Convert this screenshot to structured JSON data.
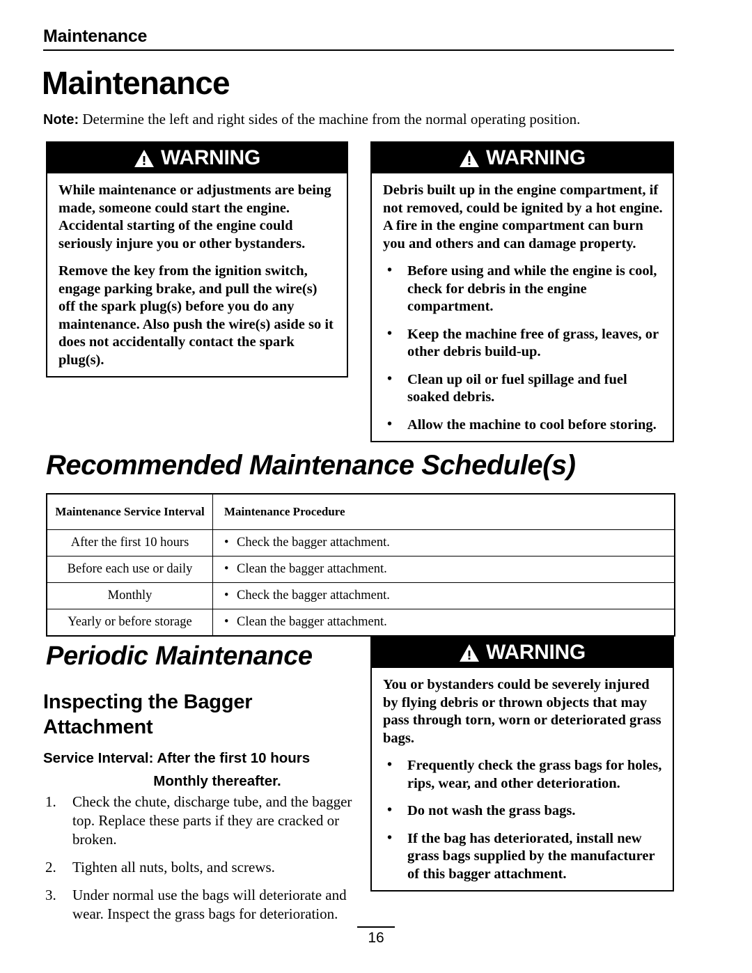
{
  "running_header": {
    "text": "Maintenance"
  },
  "page_title": "Maintenance",
  "note": {
    "label": "Note:",
    "body": " Determine the left and right sides of the machine from the normal operating position."
  },
  "warnings": {
    "label": "WARNING",
    "icon": "warning-triangle-icon",
    "left": {
      "paragraphs": [
        "While maintenance or adjustments are being made, someone could start the engine. Accidental starting of the engine could seriously injure you or other bystanders.",
        "Remove the key from the ignition switch, engage parking brake, and pull the wire(s) off the spark plug(s) before you do any maintenance.  Also push the wire(s) aside so it does not accidentally contact the spark plug(s)."
      ],
      "bullets": []
    },
    "right": {
      "paragraphs": [
        "Debris built up in the engine compartment, if not removed, could be ignited by a hot engine.  A fire in the engine compartment can burn you and others and can damage property."
      ],
      "bullet_char": "•",
      "bullets": [
        "Before using and while the engine is cool, check for debris in the engine compartment.",
        "Keep the machine free of grass, leaves, or other debris build-up.",
        "Clean up oil or fuel spillage and fuel soaked debris.",
        "Allow the machine to cool before storing."
      ]
    },
    "bagger": {
      "paragraphs": [
        "You or bystanders could be severely injured by flying debris or thrown objects that may pass through torn, worn or deteriorated grass bags."
      ],
      "bullet_char": "•",
      "bullets": [
        "Frequently check the grass bags for holes, rips, wear, and other deterioration.",
        "Do not wash the grass bags.",
        "If the bag has deteriorated, install new grass bags supplied by the manufacturer of this bagger attachment."
      ]
    }
  },
  "schedule": {
    "heading": "Recommended Maintenance Schedule(s)",
    "columns": [
      "Maintenance Service Interval",
      "Maintenance Procedure"
    ],
    "bullet_char": "•",
    "rows": [
      {
        "interval": "After the first 10 hours",
        "procedure": "Check the bagger attachment."
      },
      {
        "interval": "Before each use or daily",
        "procedure": "Clean the bagger attachment."
      },
      {
        "interval": "Monthly",
        "procedure": "Check the bagger attachment."
      },
      {
        "interval": "Yearly or before storage",
        "procedure": "Clean the bagger attachment."
      }
    ]
  },
  "periodic": {
    "heading": "Periodic Maintenance",
    "subheading": "Inspecting the Bagger Attachment",
    "service_interval_line1": "Service Interval: After the first 10 hours",
    "service_interval_line2": "Monthly thereafter.",
    "steps": [
      {
        "num": "1.",
        "text": "Check the chute, discharge tube, and the bagger top.  Replace these parts if they are cracked or broken."
      },
      {
        "num": "2.",
        "text": "Tighten all nuts, bolts, and screws."
      },
      {
        "num": "3.",
        "text": "Under normal use the bags will deteriorate and wear. Inspect the grass bags for deterioration."
      }
    ]
  },
  "footer": {
    "page_number": "16"
  }
}
